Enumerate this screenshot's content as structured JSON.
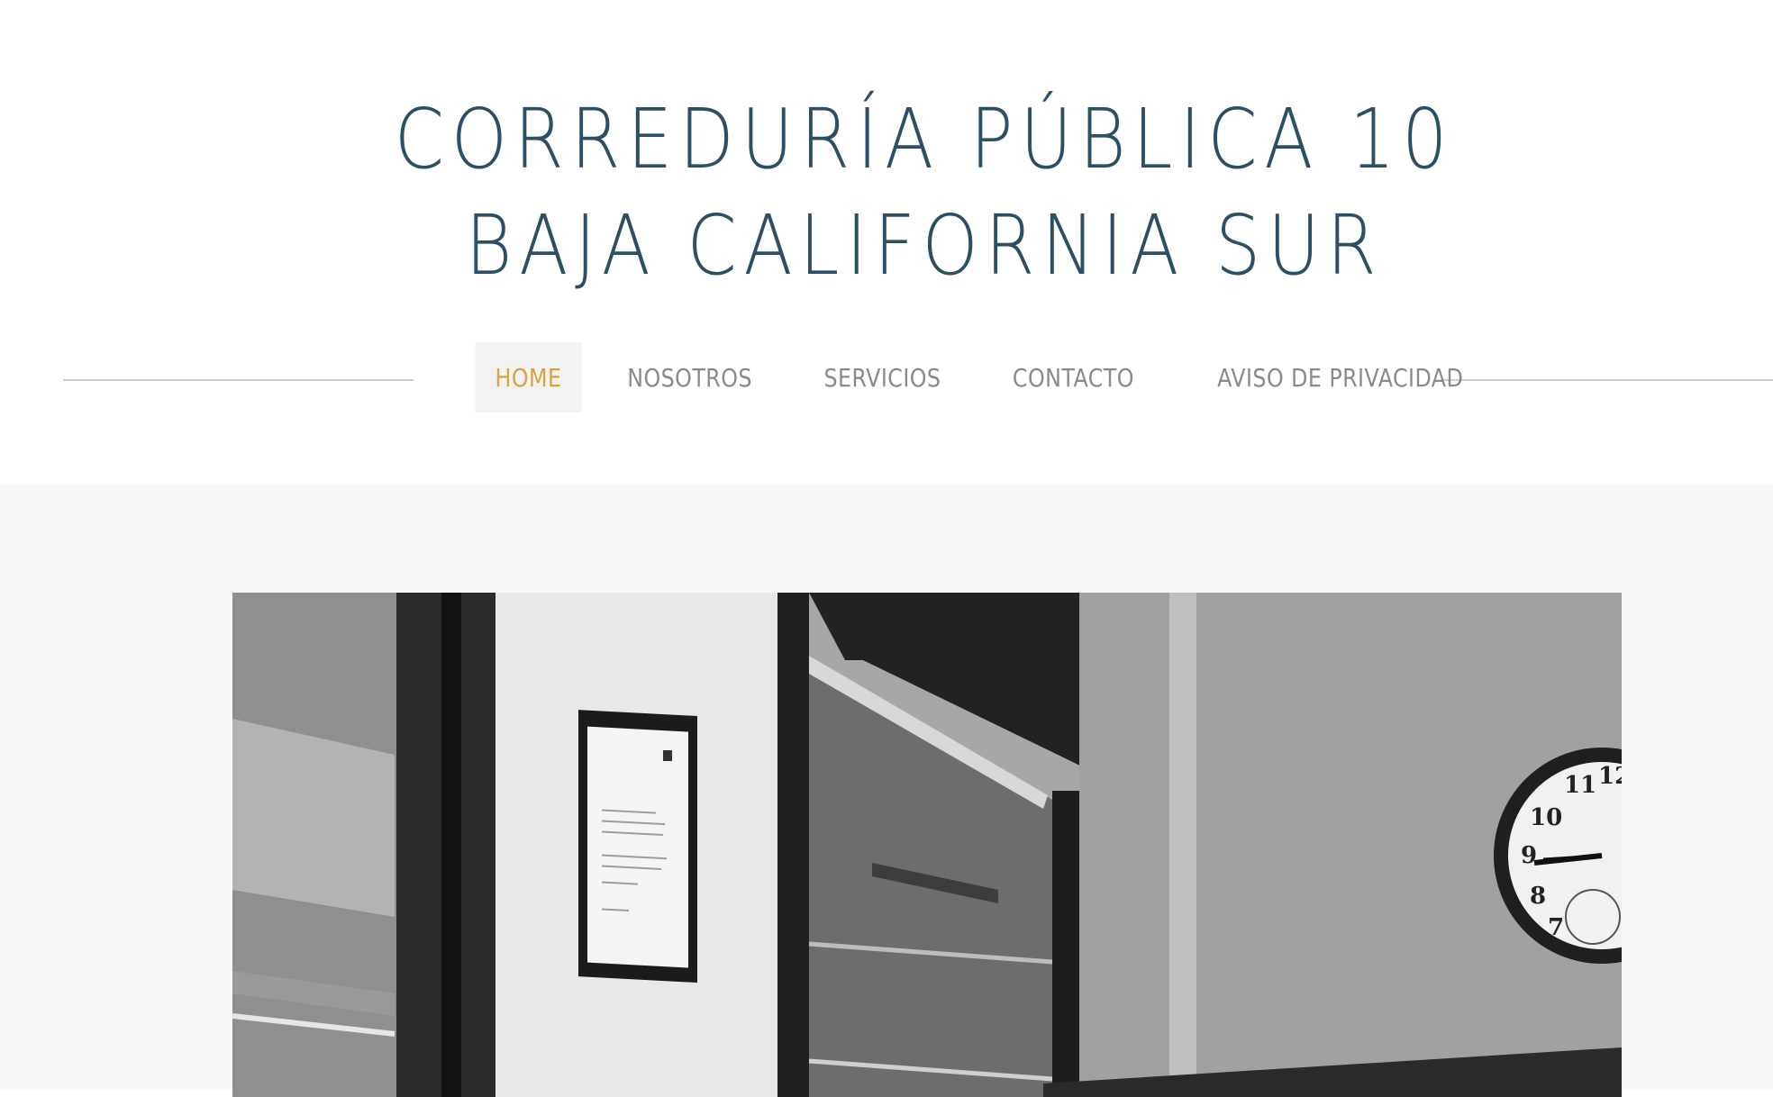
{
  "header": {
    "title_line1": "CORREDURÍA PÚBLICA 10",
    "title_line2": "BAJA CALIFORNIA SUR"
  },
  "nav": {
    "items": [
      {
        "label": "HOME",
        "active": true
      },
      {
        "label": "NOSOTROS",
        "active": false
      },
      {
        "label": "SERVICIOS",
        "active": false
      },
      {
        "label": "CONTACTO",
        "active": false
      },
      {
        "label": "AVISO DE PRIVACIDAD",
        "active": false
      }
    ]
  },
  "colors": {
    "title": "#2b4f63",
    "nav_active": "#d9a23a",
    "nav_text": "#8a8a8a",
    "hero_background": "#f8f8f8"
  },
  "hero": {
    "image": "office-interior-photo-black-and-white"
  }
}
